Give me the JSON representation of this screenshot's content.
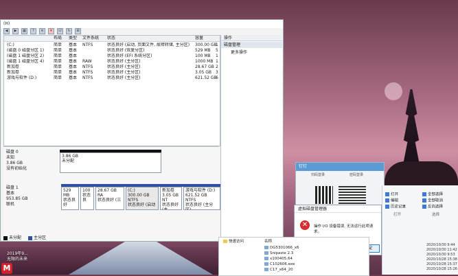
{
  "window": {
    "menu": "(H)",
    "toolbar_icons": [
      "back-icon",
      "forward-icon",
      "grid-icon",
      "help-icon",
      "list-icon",
      "delete-icon",
      "properties-icon",
      "refresh-icon",
      "tree-icon"
    ]
  },
  "volume_list": {
    "columns": [
      "",
      "布局",
      "类型",
      "文件系统",
      "状态",
      "",
      "容量",
      ""
    ],
    "rows": [
      {
        "name": "(C:)",
        "layout": "简单",
        "type": "基本",
        "fs": "NTFS",
        "status": "状态良好 (启动, 页面文件, 故障转储, 主分区)",
        "capacity": "300.00 GB",
        "extra": "1"
      },
      {
        "name": "(磁盘 0 磁盘分区 1)",
        "layout": "简单",
        "type": "基本",
        "fs": "",
        "status": "状态良好 (恢复分区)",
        "capacity": "529 MB",
        "extra": "5"
      },
      {
        "name": "(磁盘 1 磁盘分区 2)",
        "layout": "简单",
        "type": "基本",
        "fs": "",
        "status": "状态良好 (EFI 系统分区)",
        "capacity": "100 MB",
        "extra": "1"
      },
      {
        "name": "(磁盘 1 磁盘分区 4)",
        "layout": "简单",
        "type": "基本",
        "fs": "RAW",
        "status": "状态良好 (主分区)",
        "capacity": "1000 MB",
        "extra": "1"
      },
      {
        "name": "新加卷",
        "layout": "简单",
        "type": "基本",
        "fs": "NTFS",
        "status": "状态良好 (主分区)",
        "capacity": "28.67 GB",
        "extra": "2"
      },
      {
        "name": "新加卷",
        "layout": "简单",
        "type": "基本",
        "fs": "NTFS",
        "status": "状态良好 (主分区)",
        "capacity": "3.05 GB",
        "extra": "3"
      },
      {
        "name": "游戏与软件 (D:)",
        "layout": "简单",
        "type": "基本",
        "fs": "NTFS",
        "status": "状态良好 (主分区)",
        "capacity": "621.52 GB",
        "extra": "6"
      }
    ]
  },
  "ops": {
    "header": "操作",
    "section": "磁盘管理",
    "more": "更多操作"
  },
  "disk0": {
    "name": "磁盘 0",
    "type": "未知",
    "size": "3.86 GB",
    "state": "没有初始化",
    "part": {
      "size": "3.86 GB",
      "label": "未分配"
    }
  },
  "disk1": {
    "name": "磁盘 1",
    "type": "基本",
    "size": "953.85 GB",
    "state": "联机",
    "parts": [
      {
        "title": "",
        "size": "529 MB",
        "status": "状态良好"
      },
      {
        "title": "",
        "size": "100",
        "status": "状态良"
      },
      {
        "title": "",
        "size": "28.67 GB RA",
        "status": "状态良好 (三"
      },
      {
        "title": "(C:)",
        "size": "300.00 GB NTFS",
        "status": "状态良好 (启动"
      },
      {
        "title": "新加卷",
        "size": "3.05 GB NT",
        "status": "状态良好 (主"
      },
      {
        "title": "游戏与软件 (D:)",
        "size": "621.52 GB NTFS",
        "status": "状态良好 (主分区)"
      }
    ]
  },
  "legend": [
    {
      "label": "未分配",
      "color": "#111111"
    },
    {
      "label": "主分区",
      "color": "#2f4fa3"
    }
  ],
  "dialog": {
    "title": "虚拟磁盘管理器",
    "message": "操作 I/O 设备错误, 无法运行此项请求。",
    "ok": "确定"
  },
  "qr": {
    "title": "钉钉",
    "tab1": "扫码登录",
    "tab2": "密码登录"
  },
  "explorer": {
    "quick_access": "快速访问",
    "name_header": "名称",
    "files": [
      "DG5301066_x6",
      "Snipaste 2.3",
      "x100405.64",
      "C102606.exe",
      "C17_x64_20"
    ]
  },
  "ribbon": {
    "open": "打开",
    "edit": "编辑",
    "history": "历史记录",
    "select_all": "全部选择",
    "select_none": "全部取消",
    "invert": "反向选择",
    "section_open": "打开",
    "section_select": "选择",
    "dates": [
      "2020/10/30 9:44",
      "2020/10/30 11:42",
      "2020/10/30 9:53",
      "2020/10/28 15:38",
      "2020/10/28 15:37",
      "2020/10/28 15:26"
    ]
  },
  "wallpaper": {
    "date_text": "2019年9...\n无限的未来",
    "badge": "M"
  }
}
